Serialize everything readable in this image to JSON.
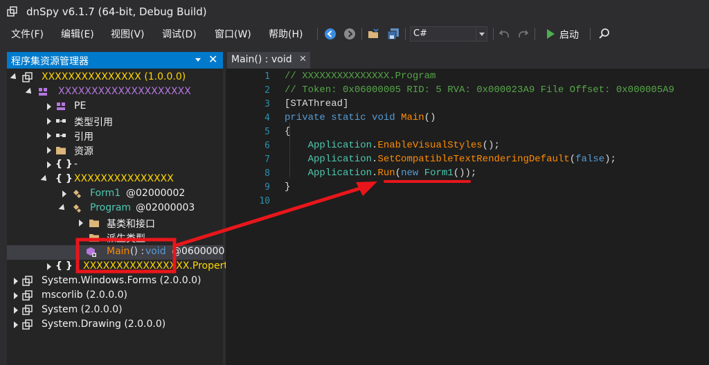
{
  "window": {
    "title": "dnSpy v6.1.7 (64-bit, Debug Build)"
  },
  "menu": {
    "items": [
      "文件(F)",
      "编辑(E)",
      "视图(V)",
      "调试(D)",
      "窗口(W)",
      "帮助(H)"
    ]
  },
  "toolbar": {
    "language": "C#",
    "start_label": "启动",
    "icons": [
      "back-icon",
      "forward-icon",
      "open-icon",
      "save-all-icon",
      "undo-icon",
      "redo-icon",
      "play-icon",
      "search-icon"
    ]
  },
  "explorer": {
    "title": "程序集资源管理器",
    "close_glyph": "✕",
    "nodes": [
      {
        "label": "XXXXXXXXXXXXXXX (1.0.0.0)",
        "icon": "assembly-icon"
      },
      {
        "label": "XXXXXXXXXXXXXXXXXXXX",
        "icon": "module-icon"
      },
      {
        "label": "PE",
        "icon": "pe-icon"
      },
      {
        "label": "类型引用",
        "icon": "type-ref-icon"
      },
      {
        "label": "引用",
        "icon": "reference-icon"
      },
      {
        "label": "资源",
        "icon": "folder-icon"
      },
      {
        "label": "-",
        "icon": "namespace-icon"
      },
      {
        "label": "XXXXXXXXXXXXXXX",
        "icon": "namespace-icon"
      },
      {
        "label": "Form1",
        "suffix": "@02000002",
        "icon": "class-icon"
      },
      {
        "label": "Program",
        "suffix": "@02000003",
        "icon": "class-icon"
      },
      {
        "label": "基类和接口",
        "icon": "folder-icon"
      },
      {
        "label": "派生类型",
        "icon": "folder-icon"
      },
      {
        "label": "Main",
        "punct": "() : ",
        "type": "void",
        "suffix": "@0600000",
        "icon": "method-icon"
      },
      {
        "label": "XXXXXXXXXXXXXXXX.Properties",
        "icon": "namespace-icon"
      },
      {
        "label": "System.Windows.Forms (2.0.0.0)",
        "icon": "assembly-icon"
      },
      {
        "label": "mscorlib (2.0.0.0)",
        "icon": "assembly-icon"
      },
      {
        "label": "System (2.0.0.0)",
        "icon": "assembly-icon"
      },
      {
        "label": "System.Drawing (2.0.0.0)",
        "icon": "assembly-icon"
      }
    ]
  },
  "editor": {
    "tab_label": "Main() : void",
    "tab_close": "✕",
    "line_numbers": [
      "1",
      "2",
      "3",
      "4",
      "5",
      "6",
      "7",
      "8",
      "9",
      "10"
    ],
    "lines": [
      {
        "comment": "// XXXXXXXXXXXXXXX.Program"
      },
      {
        "comment": "// Token: 0x06000005 RID: 5 RVA: 0x000023A9 File Offset: 0x000005A9"
      },
      {
        "attr": "[STAThread]"
      },
      {
        "kw1": "private",
        "kw2": "static",
        "kw3": "void",
        "name": "Main",
        "rest": "()"
      },
      {
        "brace": "{"
      },
      {
        "cls": "Application",
        "dot": ".",
        "method": "EnableVisualStyles",
        "rest": "();"
      },
      {
        "cls": "Application",
        "dot": ".",
        "method": "SetCompatibleTextRenderingDefault",
        "open": "(",
        "kw": "false",
        "rest": ");"
      },
      {
        "cls": "Application",
        "dot": ".",
        "method": "Run",
        "open": "(",
        "kw": "new",
        "type": "Form1",
        "rest": "());"
      },
      {
        "brace": "}"
      },
      {
        "brace": ""
      }
    ]
  },
  "colors": {
    "accent": "#007acc",
    "annotation_red": "#e8161b"
  }
}
